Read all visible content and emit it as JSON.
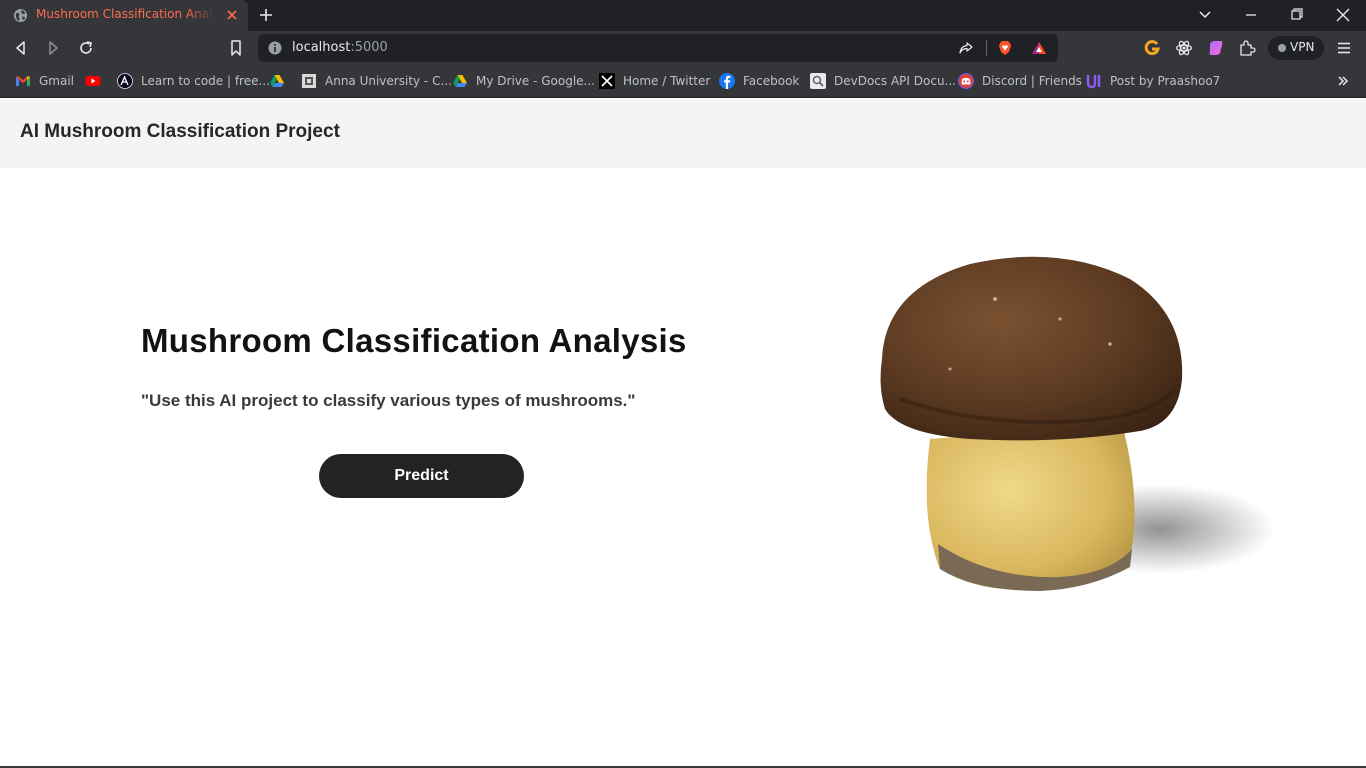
{
  "browser": {
    "tab": {
      "title": "Mushroom Classification Analysis",
      "title_color": "#ff6a4d"
    },
    "address": {
      "host": "localhost",
      "port": ":5000"
    },
    "vpn_label": "VPN",
    "bookmarks": [
      {
        "label": "Gmail",
        "icon": "gmail-icon"
      },
      {
        "label": "",
        "icon": "youtube-icon"
      },
      {
        "label": "Learn to code | free...",
        "icon": "freecodecamp-icon"
      },
      {
        "label": "",
        "icon": "google-drive-icon"
      },
      {
        "label": "Anna University - C...",
        "icon": "anna-university-icon"
      },
      {
        "label": "My Drive - Google...",
        "icon": "google-drive-icon"
      },
      {
        "label": "Home / Twitter",
        "icon": "x-twitter-icon"
      },
      {
        "label": "Facebook",
        "icon": "facebook-icon"
      },
      {
        "label": "DevDocs API Docu...",
        "icon": "devdocs-icon"
      },
      {
        "label": "Discord | Friends",
        "icon": "discord-icon"
      },
      {
        "label": "Post by Praashoo7",
        "icon": "uiverse-icon"
      }
    ]
  },
  "page": {
    "brand": "AI Mushroom Classification Project",
    "hero": {
      "title": "Mushroom Classification Analysis",
      "subtitle": "\"Use this AI project to classify various types of mushrooms.\"",
      "button": "Predict"
    },
    "colors": {
      "header_bg": "#f4f4f4",
      "button_bg": "#232323",
      "text": "#121212"
    }
  }
}
